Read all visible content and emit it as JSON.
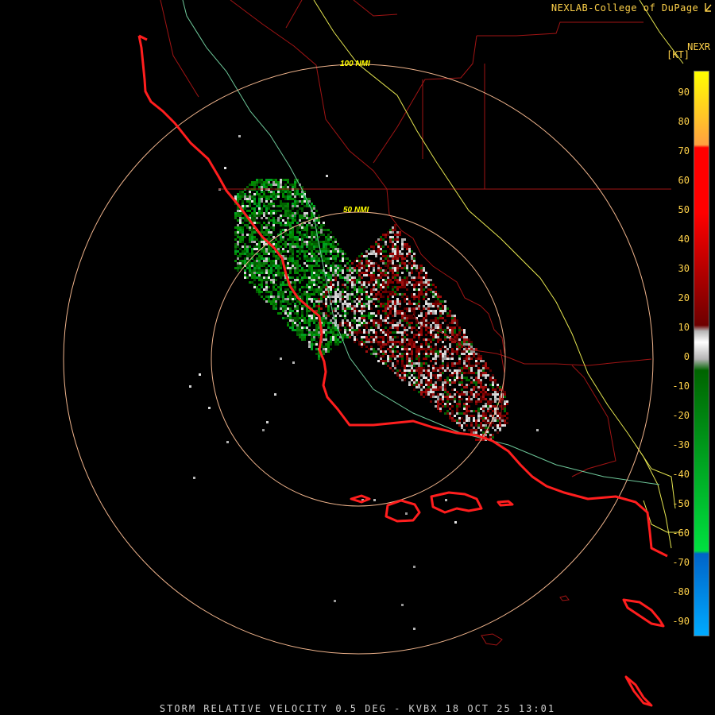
{
  "credit": "NEXLAB-College of DuPage",
  "product_code": "NEXR",
  "units": "[KT]",
  "footer": "STORM RELATIVE VELOCITY 0.5 DEG - KVBX 18 OCT 25 13:01",
  "range_rings": {
    "inner_label": "50 NMI",
    "outer_label": "100 NMI"
  },
  "scale": {
    "ticks": [
      "90",
      "80",
      "70",
      "60",
      "50",
      "40",
      "30",
      "20",
      "10",
      "0",
      "-10",
      "-20",
      "-30",
      "-40",
      "-50",
      "-60",
      "-70",
      "-80",
      "-90"
    ],
    "colors": {
      "pos_high_yellow": "#ffff00",
      "pos_orange": "#ffa040",
      "pos_red": "#ff0000",
      "pos_darkred": "#6e0000",
      "zero_gray": "#b4b4b4",
      "neg_darkgreen": "#006400",
      "neg_green": "#00e040",
      "neg_blue": "#0064c8",
      "neg_lightblue": "#00aaff"
    }
  },
  "map_colors": {
    "coastline": "#ff1e1e",
    "county_lines": "#a01414",
    "ring": "#f0b48c",
    "highway_yellow": "#e6e650",
    "highway_green": "#6ec89a"
  }
}
